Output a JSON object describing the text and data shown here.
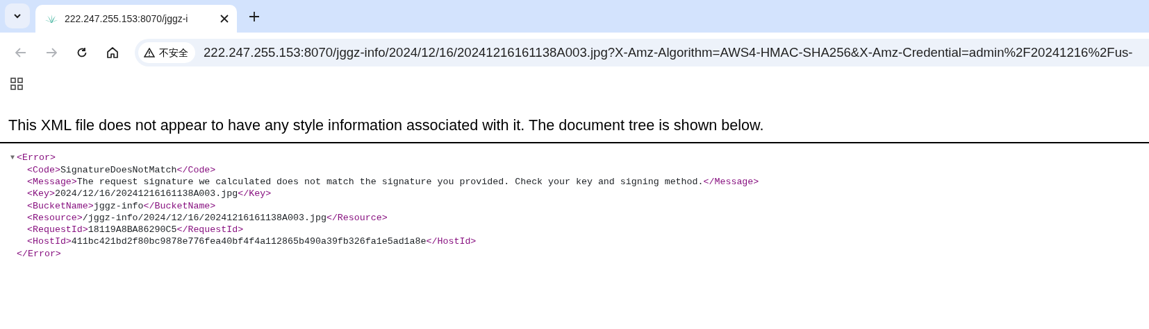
{
  "browser": {
    "tab": {
      "title": "222.247.255.153:8070/jggz-i",
      "selected": true
    },
    "address_bar": {
      "security_label": "不安全",
      "url": "222.247.255.153:8070/jggz-info/2024/12/16/20241216161138A003.jpg?X-Amz-Algorithm=AWS4-HMAC-SHA256&X-Amz-Credential=admin%2F20241216%2Fus-"
    },
    "nav": {
      "back_disabled": true,
      "forward_disabled": true
    }
  },
  "page": {
    "notice": "This XML file does not appear to have any style information associated with it. The document tree is shown below.",
    "tree": {
      "toggle": "▼",
      "expanded": true,
      "open_tag": "<Error>",
      "close_tag": "</Error>",
      "children": [
        {
          "open_tag": "<Code>",
          "text": "SignatureDoesNotMatch",
          "close_tag": "</Code>"
        },
        {
          "open_tag": "<Message>",
          "text": "The request signature we calculated does not match the signature you provided. Check your key and signing method.",
          "close_tag": "</Message>"
        },
        {
          "open_tag": "<Key>",
          "text": "2024/12/16/20241216161138A003.jpg",
          "close_tag": "</Key>"
        },
        {
          "open_tag": "<BucketName>",
          "text": "jggz-info",
          "close_tag": "</BucketName>"
        },
        {
          "open_tag": "<Resource>",
          "text": "/jggz-info/2024/12/16/20241216161138A003.jpg",
          "close_tag": "</Resource>"
        },
        {
          "open_tag": "<RequestId>",
          "text": "18119A8BA86290C5",
          "close_tag": "</RequestId>"
        },
        {
          "open_tag": "<HostId>",
          "text": "411bc421bd2f80bc9878e776fea40bf4f4a112865b490a39fb326fa1e5ad1a8e",
          "close_tag": "</HostId>"
        }
      ]
    }
  }
}
